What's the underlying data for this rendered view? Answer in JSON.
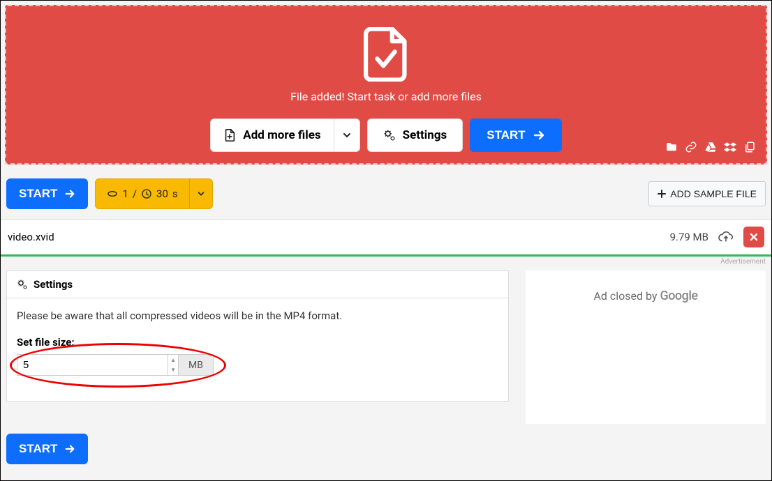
{
  "upload": {
    "message": "File added! Start task or add more files",
    "add_more_label": "Add more files",
    "settings_label": "Settings",
    "start_label": "START"
  },
  "toolbar": {
    "start_label": "START",
    "chip_count": "1",
    "chip_sep": "/",
    "chip_duration": "30",
    "chip_unit": "s",
    "add_sample_label": "ADD SAMPLE FILE"
  },
  "file": {
    "name": "video.xvid",
    "size": "9.79 MB"
  },
  "settings": {
    "header": "Settings",
    "note": "Please be aware that all compressed videos will be in the MP4 format.",
    "filesize_label": "Set file size:",
    "filesize_value": "5",
    "filesize_unit": "MB"
  },
  "bottom": {
    "start_label": "START"
  },
  "ad": {
    "label": "Advertisement",
    "text_prefix": "Ad closed by ",
    "google": "Google"
  }
}
